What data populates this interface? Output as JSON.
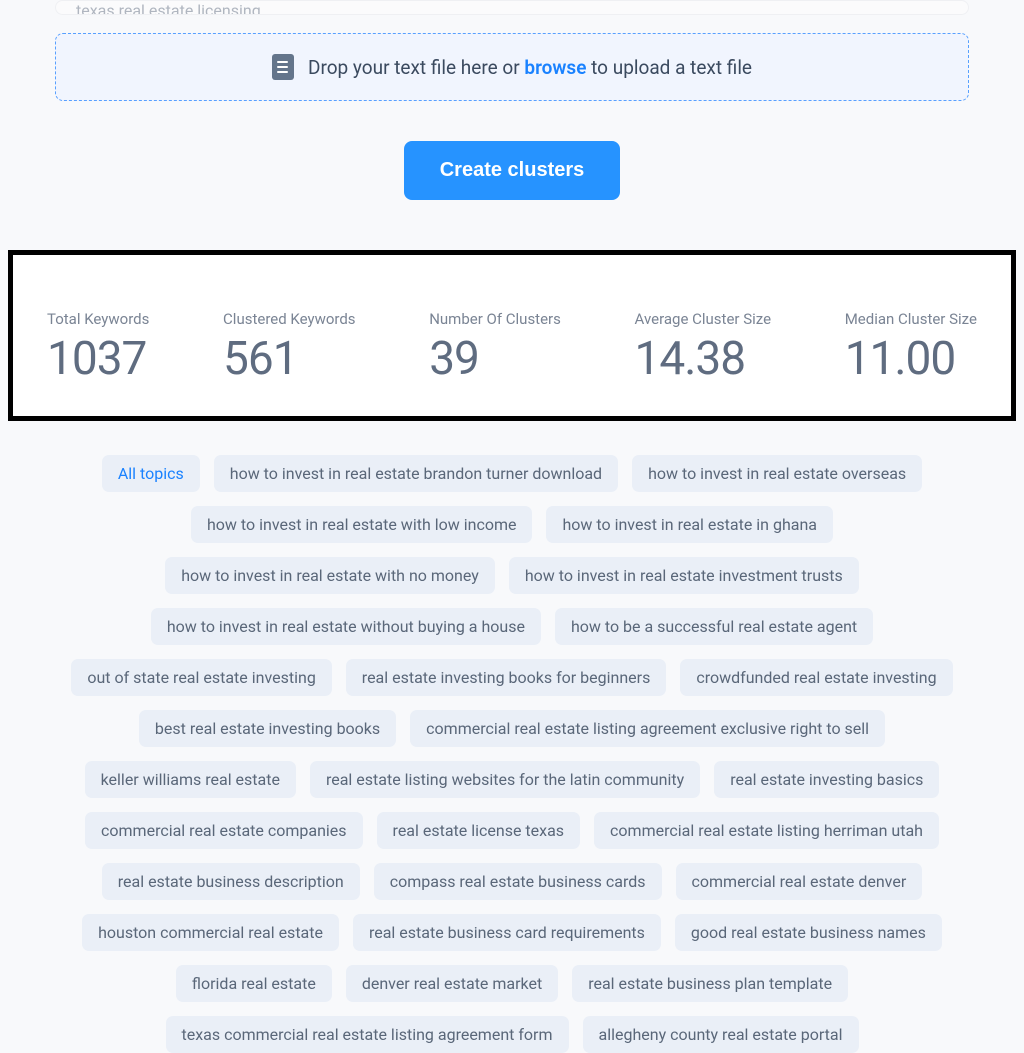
{
  "input_tail": "texas real estate licensing",
  "dropzone": {
    "text_before": "Drop your text file here or ",
    "browse": "browse",
    "text_after": " to upload a text file"
  },
  "create_button": "Create clusters",
  "stats": [
    {
      "label": "Total Keywords",
      "value": "1037"
    },
    {
      "label": "Clustered Keywords",
      "value": "561"
    },
    {
      "label": "Number Of Clusters",
      "value": "39"
    },
    {
      "label": "Average Cluster Size",
      "value": "14.38"
    },
    {
      "label": "Median Cluster Size",
      "value": "11.00"
    }
  ],
  "tags": [
    {
      "label": "All topics",
      "active": true
    },
    {
      "label": "how to invest in real estate brandon turner download"
    },
    {
      "label": "how to invest in real estate overseas"
    },
    {
      "label": "how to invest in real estate with low income"
    },
    {
      "label": "how to invest in real estate in ghana"
    },
    {
      "label": "how to invest in real estate with no money"
    },
    {
      "label": "how to invest in real estate investment trusts"
    },
    {
      "label": "how to invest in real estate without buying a house"
    },
    {
      "label": "how to be a successful real estate agent"
    },
    {
      "label": "out of state real estate investing"
    },
    {
      "label": "real estate investing books for beginners"
    },
    {
      "label": "crowdfunded real estate investing"
    },
    {
      "label": "best real estate investing books"
    },
    {
      "label": "commercial real estate listing agreement exclusive right to sell"
    },
    {
      "label": "keller williams real estate"
    },
    {
      "label": "real estate listing websites for the latin community"
    },
    {
      "label": "real estate investing basics"
    },
    {
      "label": "commercial real estate companies"
    },
    {
      "label": "real estate license texas"
    },
    {
      "label": "commercial real estate listing herriman utah"
    },
    {
      "label": "real estate business description"
    },
    {
      "label": "compass real estate business cards"
    },
    {
      "label": "commercial real estate denver"
    },
    {
      "label": "houston commercial real estate"
    },
    {
      "label": "real estate business card requirements"
    },
    {
      "label": "good real estate business names"
    },
    {
      "label": "florida real estate"
    },
    {
      "label": "denver real estate market"
    },
    {
      "label": "real estate business plan template"
    },
    {
      "label": "texas commercial real estate listing agreement form"
    },
    {
      "label": "allegheny county real estate portal"
    }
  ]
}
